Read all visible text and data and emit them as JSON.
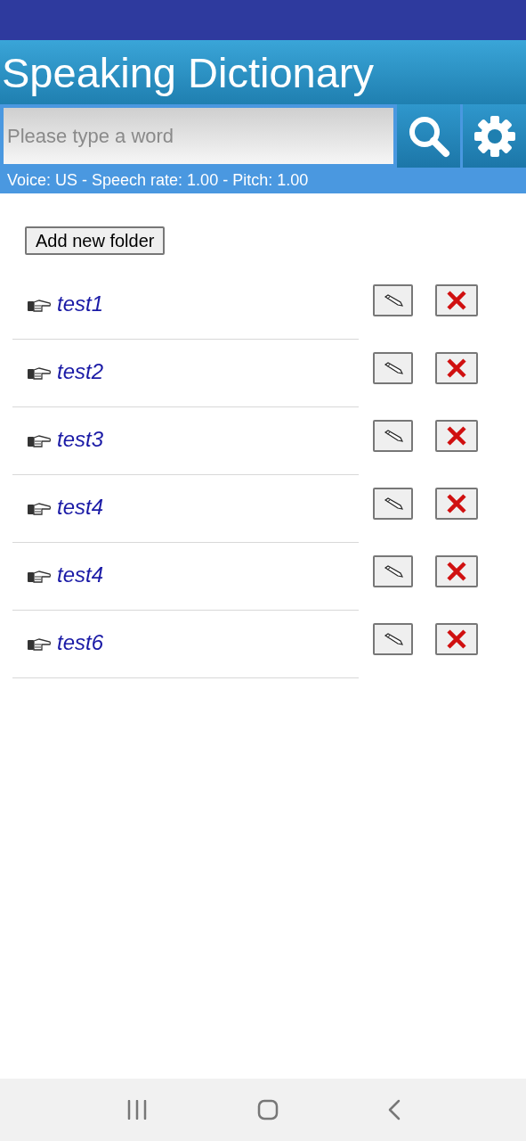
{
  "app_title": "Speaking Dictionary",
  "search": {
    "placeholder": "Please type a word"
  },
  "settings_info": "Voice: US - Speech rate: 1.00 - Pitch: 1.00",
  "add_folder_button": "Add new folder",
  "folders": [
    {
      "name": "test1"
    },
    {
      "name": "test2"
    },
    {
      "name": "test3"
    },
    {
      "name": "test4"
    },
    {
      "name": "test4"
    },
    {
      "name": "test6"
    }
  ]
}
